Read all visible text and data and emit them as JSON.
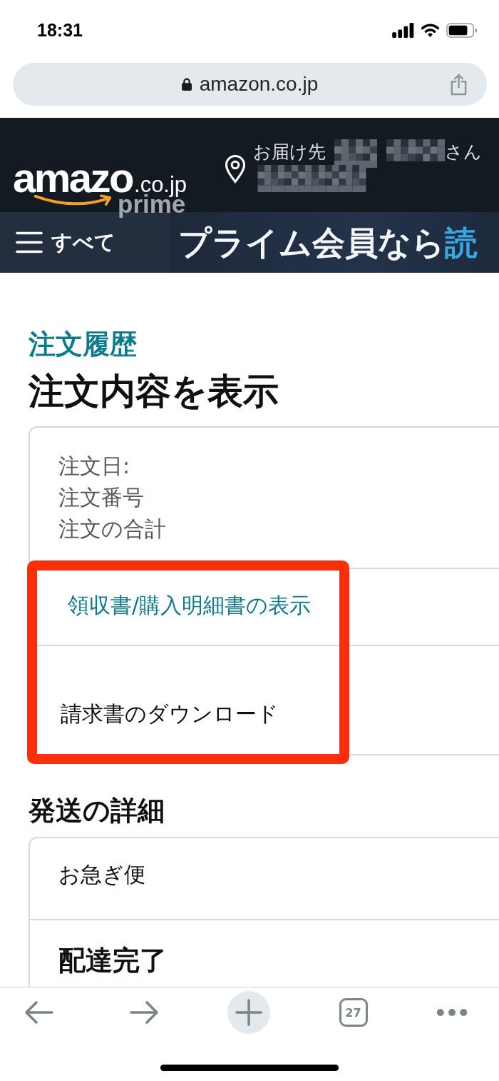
{
  "status_bar": {
    "time": "18:31"
  },
  "browser": {
    "url": "amazon.co.jp",
    "secure": true
  },
  "header": {
    "logo": {
      "wordmark": "amazo",
      "domain": ".co.jp",
      "badge": "prime"
    },
    "delivery": {
      "label": "お届け先",
      "suffix": "さん"
    }
  },
  "nav": {
    "menu_label": "すべて",
    "banner": {
      "text": "プライム会員なら",
      "highlight": "読"
    }
  },
  "breadcrumb": "注文履歴",
  "title": "注文内容を表示",
  "order_card": {
    "rows": [
      {
        "kind": "summary",
        "lines": [
          "注文日:",
          "注文番号",
          "注文の合計"
        ],
        "highlighted": false
      },
      {
        "kind": "link",
        "text": "領収書/購入明細書の表示",
        "highlighted": true
      },
      {
        "kind": "action",
        "text": "請求書のダウンロード",
        "highlighted": true
      }
    ]
  },
  "shipping": {
    "heading": "発送の詳細",
    "rows": [
      {
        "kind": "plain",
        "text": "お急ぎ便"
      },
      {
        "kind": "status",
        "text": "配達完了"
      }
    ]
  },
  "toolbar": {
    "buttons": [
      {
        "kind": "back"
      },
      {
        "kind": "forward"
      },
      {
        "kind": "new_tab"
      },
      {
        "kind": "tabs",
        "label": "27"
      },
      {
        "kind": "more"
      }
    ]
  }
}
